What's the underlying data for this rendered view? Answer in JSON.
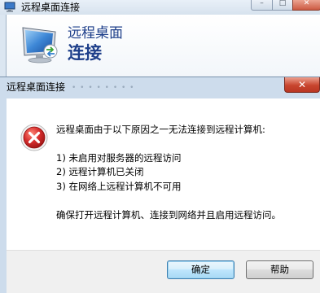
{
  "background_window": {
    "title": "远程桌面连接",
    "heading_line1": "远程桌面",
    "heading_line2": "连接",
    "minimize_icon": "minimize-icon",
    "maximize_icon": "maximize-icon",
    "close_icon": "close-icon"
  },
  "dialog": {
    "title": "远程桌面连接",
    "ghost_text": "• • • • • • • •",
    "close_icon": "close-icon",
    "icon": "error-icon",
    "message": "远程桌面由于以下原因之一无法连接到远程计算机:",
    "reasons": [
      "1) 未启用对服务器的远程访问",
      "2) 远程计算机已关闭",
      "3) 在网络上远程计算机不可用"
    ],
    "advice": "确保打开远程计算机、连接到网络并且启用远程访问。",
    "buttons": {
      "ok": "确定",
      "help": "帮助"
    }
  },
  "colors": {
    "heading_text": "#1e3f8a",
    "error_red": "#d62d2d",
    "close_red": "#c8452e",
    "dialog_frame": "#cddcec"
  }
}
